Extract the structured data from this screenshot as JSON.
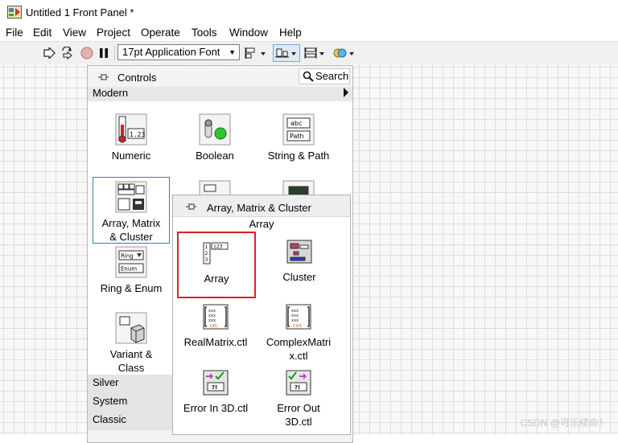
{
  "window": {
    "title": "Untitled 1 Front Panel *"
  },
  "menu": [
    "File",
    "Edit",
    "View",
    "Project",
    "Operate",
    "Tools",
    "Window",
    "Help"
  ],
  "toolbar": {
    "font": "17pt Application Font",
    "icons": [
      "run-arrow-icon",
      "run-continuous-icon",
      "abort-icon",
      "pause-icon",
      "align-objects-icon",
      "distribute-objects-icon",
      "resize-objects-icon",
      "reorder-icon"
    ]
  },
  "controls_palette": {
    "title": "Controls",
    "search_label": "Search",
    "category": "Modern",
    "items": [
      {
        "label": "Numeric",
        "icon": "numeric-icon"
      },
      {
        "label": "Boolean",
        "icon": "boolean-icon"
      },
      {
        "label": "String & Path",
        "icon": "string-path-icon"
      },
      {
        "label": "Array, Matrix\n& Cluster",
        "icon": "array-matrix-cluster-icon"
      },
      {
        "label": "Ring & Enum",
        "icon": "ring-enum-icon"
      },
      {
        "label": "Variant &\nClass",
        "icon": "variant-class-icon"
      }
    ],
    "categories": [
      "Silver",
      "System",
      "Classic"
    ]
  },
  "sub_palette": {
    "title": "Array, Matrix & Cluster",
    "hover_label": "Array",
    "items": [
      {
        "label": "Array",
        "icon": "array-icon"
      },
      {
        "label": "Cluster",
        "icon": "cluster-icon"
      },
      {
        "label": "RealMatrix.ctl",
        "icon": "real-matrix-icon"
      },
      {
        "label": "ComplexMatri\nx.ctl",
        "icon": "complex-matrix-icon"
      },
      {
        "label": "Error In 3D.ctl",
        "icon": "error-in-icon"
      },
      {
        "label": "Error Out\n3D.ctl",
        "icon": "error-out-icon"
      }
    ]
  },
  "watermark": "CSDN @可乐续命！"
}
